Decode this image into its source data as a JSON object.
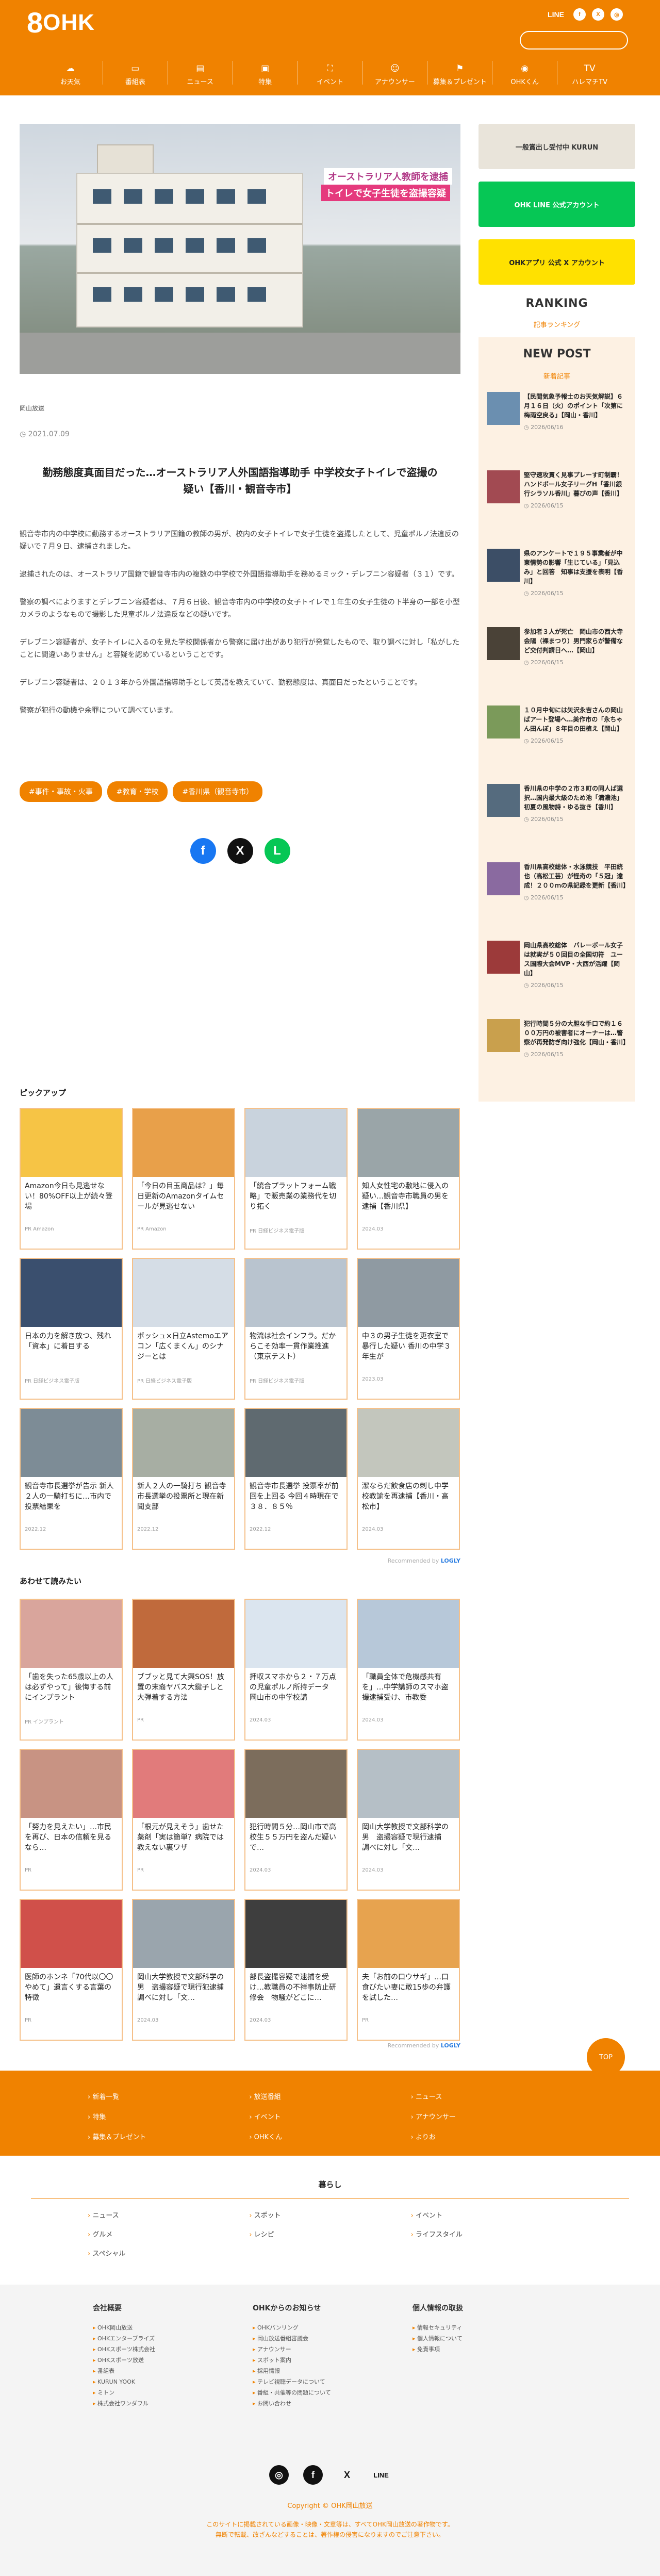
{
  "header": {
    "logo_num": "8",
    "logo_text": "OHK",
    "social": [
      "LINE",
      "f",
      "X",
      "◎"
    ],
    "search_placeholder": "",
    "nav": [
      {
        "icon": "☁",
        "label": "お天気"
      },
      {
        "icon": "▭",
        "label": "番組表"
      },
      {
        "icon": "▤",
        "label": "ニュース"
      },
      {
        "icon": "▣",
        "label": "特集"
      },
      {
        "icon": "⛶",
        "label": "イベント"
      },
      {
        "icon": "☺",
        "label": "アナウンサー"
      },
      {
        "icon": "⚑",
        "label": "募集＆プレゼント"
      },
      {
        "icon": "◉",
        "label": "OHKくん"
      },
      {
        "icon": "TV",
        "label": "ハレマチTV"
      }
    ]
  },
  "article": {
    "hero_caption_1": "オーストラリア人教師を逮捕",
    "hero_caption_2": "トイレで女子生徒を盗撮容疑",
    "source": "岡山放送",
    "date": "◷ 2021.07.09",
    "title": "勤務態度真面目だった…オーストラリア人外国語指導助手 中学校女子トイレで盗撮の疑い【香川・観音寺市】",
    "paragraphs": [
      "観音寺市内の中学校に勤務するオーストラリア国籍の教師の男が、校内の女子トイレで女子生徒を盗撮したとして、児童ポルノ法違反の疑いで７月９日、逮捕されました。",
      "逮捕されたのは、オーストラリア国籍で観音寺市内の複数の中学校で外国語指導助手を務めるミック・デレブニン容疑者（３１）です。",
      "警察の調べによりますとデレブニン容疑者は、７月６日後、観音寺市内の中学校の女子トイレで１年生の女子生徒の下半身の一部を小型カメラのようなもので撮影した児童ポルノ法違反などの疑いです。",
      "デレブニン容疑者が、女子トイレに入るのを見た学校関係者から警察に届け出があり犯行が発覚したもので、取り調べに対し「私がしたことに間違いありません」と容疑を認めているということです。",
      "デレブニン容疑者は、２０１３年から外国語指導助手として英語を教えていて、勤務態度は、真面目だったということです。",
      "警察が犯行の動機や余罪について調べています。"
    ],
    "tags": [
      "#事件・事故・火事",
      "#教育・学校",
      "#香川県（観音寺市）"
    ],
    "share": [
      "f",
      "X",
      "L"
    ]
  },
  "pickup": {
    "heading": "ピックアップ",
    "recommend": "Recommended by",
    "brand": "LOGLY",
    "items": [
      {
        "title": "Amazon今日も見逃せない！80%OFF以上が続々登場",
        "source": "PR Amazon",
        "color": "#f6c445"
      },
      {
        "title": "「今日の目玉商品は？」毎日更新のAmazonタイムセールが見逃せない",
        "source": "PR Amazon",
        "color": "#e8a04a"
      },
      {
        "title": "「統合プラットフォーム戦略」で販売業の業務代を切り拓く",
        "source": "PR 日経ビジネス電子版",
        "color": "#c9d3dd"
      },
      {
        "title": "知人女性宅の敷地に侵入の疑い…観音寺市職員の男を逮捕【香川県】",
        "source": "2024.03",
        "color": "#9aa5a8"
      },
      {
        "title": "日本の力を解き放つ、残れ「資本」に着目する",
        "source": "PR 日経ビジネス電子版",
        "color": "#3a4f6e"
      },
      {
        "title": "ボッシュ×日立Astemoエアコン「広くまくん」のシナジーとは",
        "source": "PR 日経ビジネス電子版",
        "color": "#d5dde6"
      },
      {
        "title": "物流は社会インフラ。だからこそ効率一貫作業推進（東京テスト）",
        "source": "PR 日経ビジネス電子版",
        "color": "#b9c4cf"
      },
      {
        "title": "中３の男子生徒を更衣室で暴行した疑い 香川の中学３年生が",
        "source": "2023.03",
        "color": "#8f9aa2"
      },
      {
        "title": "観音寺市長選挙が告示 新人２人の一騎打ちに…市内で投票結果を",
        "source": "2022.12",
        "color": "#7d8c96"
      },
      {
        "title": "新人２人の一騎打ち 観音寺市長選挙の投票所と現在新聞支部",
        "source": "2022.12",
        "color": "#a7aea3"
      },
      {
        "title": "観音寺市長選挙 投票率が前回を上回る 今回４時現在で３８．８５％",
        "source": "2022.12",
        "color": "#5f6a70"
      },
      {
        "title": "潔ならだ飲食店の刺し中学校教諭を再逮捕【香川・高松市】",
        "source": "2024.03",
        "color": "#c3c6bd"
      }
    ]
  },
  "related": {
    "heading": "あわせて読みたい",
    "recommend": "Recommended by",
    "brand": "LOGLY",
    "items": [
      {
        "title": "「歯を失った65歳以上の人は必ずやって」後悔する前にインプラント",
        "source": "PR インプラント",
        "color": "#d9a59c"
      },
      {
        "title": "ブブッと見て大興SOS！放置の末裔ヤバス大鍵子しと大弾着する方法",
        "source": "PR",
        "color": "#c06a3c"
      },
      {
        "title": "押収スマホから２・７万点の児童ポルノ所持データ　岡山市の中学校講",
        "source": "2024.03",
        "color": "#dbe5ef"
      },
      {
        "title": "「職員全体で危機感共有を」…中学講師のスマホ盗撮逮捕受け、市教委",
        "source": "2024.03",
        "color": "#b7c8d9"
      },
      {
        "title": "「努力を見えたい」…市民を再び、日本の信頼を見るなら…",
        "source": "PR",
        "color": "#c89383"
      },
      {
        "title": "「根元が見えそう」歯せた薬剤「実は簡単？病院では教えない裏ワザ",
        "source": "PR",
        "color": "#e17b7b"
      },
      {
        "title": "犯行時間５分…岡山市で高校生５５万円を盗んだ疑いで…",
        "source": "2024.03",
        "color": "#7c6d5c"
      },
      {
        "title": "岡山大学教授で文部科学の男　盗撮容疑で現行逮捕　調べに対し「文…",
        "source": "2024.03",
        "color": "#b5bfc6"
      },
      {
        "title": "医師のホンネ「70代以〇〇やめて」遺言くする言葉の特徴",
        "source": "PR",
        "color": "#d0504a"
      },
      {
        "title": "岡山大学教授で文部科学の男　盗撮容疑で現行犯逮捕　調べに対し「文…",
        "source": "2024.03",
        "color": "#9aa5ad"
      },
      {
        "title": "部長盗撮容疑で逮捕を受け…教職員の不祥事防止研修会　物騒がどこに…",
        "source": "2024.03",
        "color": "#3e3e3e"
      },
      {
        "title": "夫「お前の口ウサギ」…口食びたい妻に敢15歩の弁護を試した…",
        "source": "PR",
        "color": "#e7a34f"
      }
    ]
  },
  "sidebar": {
    "banners": [
      {
        "label": "一般賞出し受付中  KURUN",
        "bg": "#e9e4da",
        "fg": "#333"
      },
      {
        "label": "OHK  LINE 公式アカウント",
        "bg": "#06c755",
        "fg": "#fff"
      },
      {
        "label": "OHKアプリ  公式 X アカウント",
        "bg": "#ffe100",
        "fg": "#222"
      }
    ],
    "ranking_title": "RANKING",
    "ranking_sub": "記事ランキング",
    "newpost_title": "NEW POST",
    "newpost_sub": "新着記事",
    "posts": [
      {
        "title": "【民間気象予報士のお天気解説】６月１６日（火）のポイント「次第に梅雨空戻る」【岡山・香川】",
        "date": "◷ 2026/06/16",
        "color": "#6b8fb0"
      },
      {
        "title": "堅守速攻貫く見事プレーす町制霸！ハンドボール女子リーグH「香川銀行シラソル香川」暮びの声【香川】",
        "date": "◷ 2026/06/15",
        "color": "#a24a52"
      },
      {
        "title": "県のアンケートで１９５事業者が中東情勢の影響「生じている」「見込み」と回答　知事は支援を表明【香川】",
        "date": "◷ 2026/06/15",
        "color": "#3c4e66"
      },
      {
        "title": "参加者３人が死亡　岡山市の西大寺会陽（裸まつり）男門家らが警備など交付判請日へ…【岡山】",
        "date": "◷ 2026/06/15",
        "color": "#4a4237"
      },
      {
        "title": "１０月中旬には矢沢永吉さんの岡山ばアート登場へ…美作市の「永ちゃん田んぼ」８年目の田植え【岡山】",
        "date": "◷ 2026/06/15",
        "color": "#7b9a5a"
      },
      {
        "title": "香川県の中学の２市３町の同人ば選択…国内最大級のため池「満濃池」初夏の風物詩・ゆる抜き【香川】",
        "date": "◷ 2026/06/15",
        "color": "#556b7e"
      },
      {
        "title": "香川県高校総体・水泳競技　平田統也（高松工芸）が怪奇の「５冠」達成！２００ｍの県記録を更新【香川】",
        "date": "◷ 2026/06/15",
        "color": "#8a6aa0"
      },
      {
        "title": "岡山県高校総体　バレーボール女子は就実が５０回目の全国切符　ユース国際大会MVP・大西が活躍【岡山】",
        "date": "◷ 2026/06/15",
        "color": "#9c3a3a"
      },
      {
        "title": "犯行時間５分の大胆な手口で約１６００万円の被害者にオーナーは…警察が再発防ぎ向け強化【岡山・香川】",
        "date": "◷ 2026/06/15",
        "color": "#c9a04d"
      }
    ]
  },
  "footer": {
    "nav": [
      "新着一覧",
      "放送番組",
      "ニュース",
      "特集",
      "イベント",
      "アナウンサー",
      "募集＆プレゼント",
      "OHKくん",
      "よりお"
    ],
    "top_label": "TOP",
    "kurashi_heading": "暮らし",
    "kurashi": [
      "ニュース",
      "スポット",
      "イベント",
      "グルメ",
      "レシピ",
      "ライフスタイル",
      "スペシャル"
    ],
    "info_cols": [
      {
        "heading": "会社概要",
        "items": [
          "OHK岡山放送",
          "OHKエンターブライズ",
          "OHKスポーツ株式会社",
          "OHKスポーツ放送",
          "番組表",
          "KURUN YOOK",
          "ミトン",
          "株式会社ワンダフル"
        ]
      },
      {
        "heading": "OHKからのお知らせ",
        "items": [
          "OHKバンリング",
          "岡山放送番組審議会",
          "アナウンサー",
          "スポット案内",
          "採用情報",
          "テレビ視聴データについて",
          "番組・共催等の問題について",
          "お問い合わせ"
        ]
      },
      {
        "heading": "個人情報の取扱",
        "items": [
          "情報セキュリティ",
          "個人情報について",
          "免責事項"
        ]
      }
    ],
    "social": [
      "◎",
      "f",
      "X",
      "LINE"
    ],
    "copyright": "Copyright © OHK岡山放送",
    "note_1": "このサイトに掲載されている画像・映像・文章等は、すべてOHK岡山放送の著作物です。",
    "note_2": "無断で転載、改ざんなどすることは、著作権の侵害になりますのでご注意下さい。"
  }
}
